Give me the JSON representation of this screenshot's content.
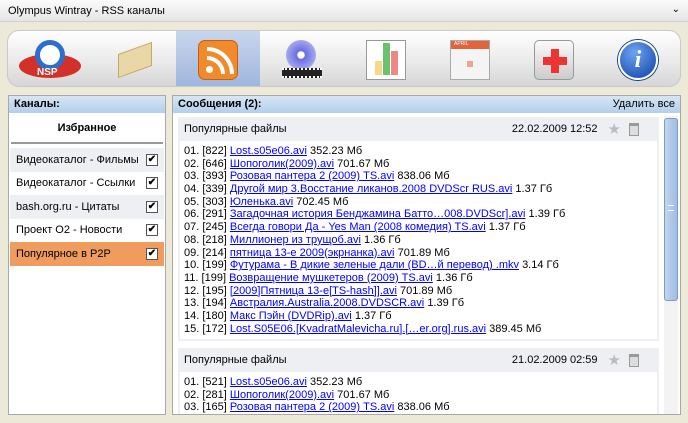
{
  "window": {
    "title": "Olympus Wintray - RSS каналы",
    "menu_icon": "chevron-down-icon"
  },
  "toolbar": {
    "items": [
      {
        "name": "olympus-logo",
        "label": "NSP",
        "active": false
      },
      {
        "name": "mail",
        "active": false
      },
      {
        "name": "rss",
        "active": true
      },
      {
        "name": "video",
        "active": false
      },
      {
        "name": "statistics",
        "active": false
      },
      {
        "name": "calendar",
        "label": "APRIL",
        "active": false
      },
      {
        "name": "first-aid",
        "active": false
      },
      {
        "name": "info",
        "label": "i",
        "active": false
      }
    ]
  },
  "channels": {
    "title": "Каналы:",
    "favorites": "Избранное",
    "check": "✔",
    "items": [
      {
        "label": "Видеокаталог - Фильмы",
        "checked": true
      },
      {
        "label": "Видеокаталог - Ссылки",
        "checked": true
      },
      {
        "label": "bash.org.ru - Цитаты",
        "checked": true
      },
      {
        "label": "Проект O2 - Новости",
        "checked": true
      },
      {
        "label": "Популярное в P2P",
        "checked": true,
        "selected": true
      }
    ]
  },
  "messages": {
    "title": "Сообщения (2):",
    "delete_all": "Удалить все",
    "star": "★",
    "cards": [
      {
        "title": "Популярные файлы",
        "date": "22.02.2009 12:52",
        "lines": [
          {
            "n": "01. [822]",
            "link": "Lost.s05e06.avi",
            "size": "352.23 Мб"
          },
          {
            "n": "02. [646]",
            "link": "Шопоголик(2009).avi",
            "size": "701.67 Мб"
          },
          {
            "n": "03. [393]",
            "link": "Розовая пантера 2 (2009) TS.avi",
            "size": "838.06 Мб"
          },
          {
            "n": "04. [339]",
            "link": "Другой мир 3.Восстание ликанов.2008 DVDScr RUS.avi",
            "size": "1.37 Гб"
          },
          {
            "n": "05. [303]",
            "link": "Юленька.avi",
            "size": "702.45 Мб"
          },
          {
            "n": "06. [291]",
            "link": "Загадочная история Бенджамина Батто…008.DVDScr].avi",
            "size": "1.39 Гб"
          },
          {
            "n": "07. [245]",
            "link": "Всегда говори Да - Yes Man (2008 комедия) TS.avi",
            "size": "1.37 Гб"
          },
          {
            "n": "08. [218]",
            "link": "Миллионер из трущоб.avi",
            "size": "1.36 Гб"
          },
          {
            "n": "09. [214]",
            "link": "пятница 13-е 2009(экрнанка).avi",
            "size": "701.89 Мб"
          },
          {
            "n": "10. [199]",
            "link": "Футурама - В дикие зеленые дали (BD…й перевод) .mkv",
            "size": "3.14 Гб"
          },
          {
            "n": "11. [199]",
            "link": "Возвращение мушкетеров (2009) TS.avi",
            "size": "1.36 Гб"
          },
          {
            "n": "12. [195]",
            "link": "[2009]Пятница 13-е[TS-hash]].avi",
            "size": "701.89 Мб"
          },
          {
            "n": "13. [194]",
            "link": "Австралия.Australia.2008.DVDSCR.avi",
            "size": "1.39 Гб"
          },
          {
            "n": "14. [180]",
            "link": "Макс Пэйн (DVDRip).avi",
            "size": "1.37 Гб"
          },
          {
            "n": "15. [172]",
            "link": "Lost.S05E06.[KvadratMalevicha.ru].[…er.org].rus.avi",
            "size": "389.45 Мб"
          }
        ]
      },
      {
        "title": "Популярные файлы",
        "date": "21.02.2009 02:59",
        "lines": [
          {
            "n": "01. [521]",
            "link": "Lost.s05e06.avi",
            "size": "352.23 Мб"
          },
          {
            "n": "02. [281]",
            "link": "Шопоголик(2009).avi",
            "size": "701.67 Мб"
          },
          {
            "n": "03. [165]",
            "link": "Розовая пантера 2 (2009) TS.avi",
            "size": "838.06 Мб"
          }
        ]
      }
    ]
  },
  "colors": {
    "accent": "#f09c5e",
    "link": "#0000ff",
    "header": "#b3cfea"
  }
}
